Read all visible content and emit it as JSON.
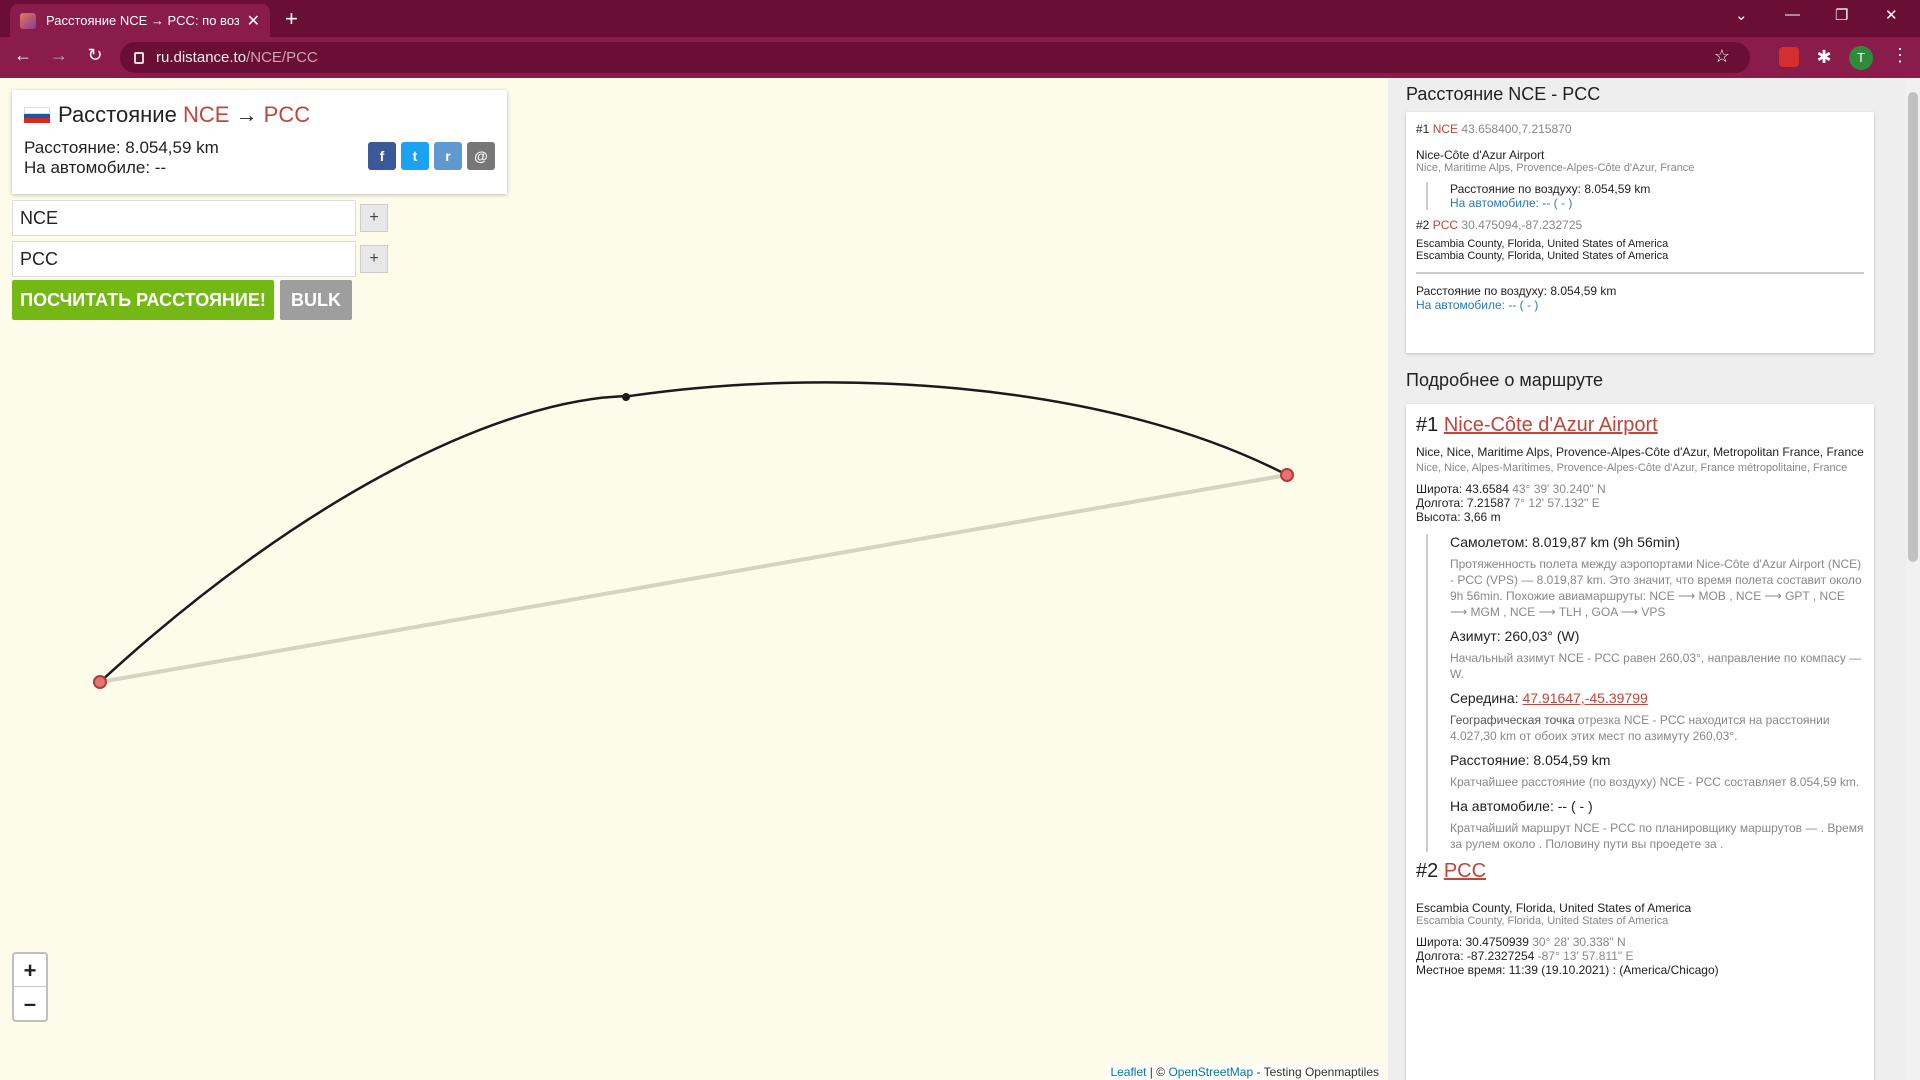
{
  "browser": {
    "tab_title": "Расстояние NCE → PCC: по возд",
    "url_host": "ru.distance.to",
    "url_path": "/NCE/PCC",
    "profile_initial": "T"
  },
  "header": {
    "title_prefix": "Расстояние",
    "from": "NCE",
    "arrow": "→",
    "to": "PCC",
    "distance": "Расстояние: 8.054,59 km",
    "drive": "На автомобиле: --"
  },
  "share": {
    "facebook": "f",
    "twitter": "t",
    "reddit": "r",
    "email": "@"
  },
  "form": {
    "from_value": "NCE",
    "to_value": "PCC",
    "plus": "+",
    "calc_label": "ПОСЧИТАТЬ РАССТОЯНИЕ!",
    "bulk_label": "BULK"
  },
  "map": {
    "zoom_in": "+",
    "zoom_out": "–",
    "attr_leaflet": "Leaflet",
    "attr_sep": " | © ",
    "attr_osm": "OpenStreetMap",
    "attr_rest": " - Testing Openmaptiles"
  },
  "summary": {
    "heading": "Расстояние NCE - PCC",
    "p1_num": "#1",
    "p1_code": "NCE",
    "p1_coords": "43.658400,7.215870",
    "p1_name": "Nice-Côte d'Azur Airport",
    "p1_region": "Nice, Maritime Alps, Provence-Alpes-Côte d'Azur, France",
    "leg_air": "Расстояние по воздуху: 8.054,59 km",
    "leg_drive": "На автомобиле: -- ( - )",
    "p2_num": "#2",
    "p2_code": "PCC",
    "p2_coords": "30.475094,-87.232725",
    "p2_region1": "Escambia County, Florida, United States of America",
    "p2_region2": "Escambia County, Florida, United States of America",
    "total_air": "Расстояние по воздуху: 8.054,59 km",
    "total_drive": "На автомобиле: -- ( - )"
  },
  "details": {
    "heading": "Подробнее о маршруте",
    "p1_num": "#1",
    "p1_name": "Nice-Côte d'Azur Airport",
    "p1_addr": "Nice, Nice, Maritime Alps, Provence-Alpes-Côte d'Azur, Metropolitan France, France",
    "p1_addr_local": "Nice, Nice, Alpes-Maritimes, Provence-Alpes-Côte d'Azur, France métropolitaine, France",
    "p1_lat_label": "Широта: 43.6584",
    "p1_lat_dms": "43° 39' 30.240\" N",
    "p1_lon_label": "Долгота: 7.21587",
    "p1_lon_dms": "7° 12' 57.132\" E",
    "p1_alt": "Высота: 3,66 m",
    "flight_title": "Самолетом: 8.019,87 km (9h 56min)",
    "flight_desc": "Протяженность полета между аэропортами Nice-Côte d'Azur Airport (NCE) - PCC (VPS) — 8.019,87 km. Это значит, что время полета составит около 9h 56min. Похожие авиамаршруты: NCE ⟶ MOB , NCE ⟶ GPT , NCE ⟶ MGM , NCE ⟶ TLH , GOA ⟶ VPS",
    "azimuth_title": "Азимут: 260,03° (W)",
    "azimuth_desc": "Начальный азимут NCE - PCC равен 260,03°, направление по компасу — W.",
    "mid_title": "Середина: ",
    "mid_link": "47.91647,-45.39799",
    "mid_desc_a": "Географическая точка",
    "mid_desc_b": " отрезка NCE - PCC находится на расстоянии 4.027,30 km от обоих этих мест по азимуту 260,03°.",
    "dist_title": "Расстояние: 8.054,59 km",
    "dist_desc": "Кратчайшее расстояние (по воздуху) NCE - PCC составляет 8.054,59 km.",
    "drive_title": "На автомобиле: -- ( - )",
    "drive_desc": "Кратчайший маршрут NCE - PCC по планировщику маршрутов — . Время за рулем около . Половину пути вы проедете за .",
    "p2_num": "#2",
    "p2_name": "PCC",
    "p2_addr": "Escambia County, Florida, United States of America",
    "p2_addr_local": "Escambia County, Florida, United States of America",
    "p2_lat_label": "Широта: 30.4750939",
    "p2_lat_dms": "30° 28' 30.338\" N",
    "p2_lon_label": "Долгота: -87.2327254",
    "p2_lon_dms": "-87° 13' 57.811\" E",
    "p2_time": "Местное время: 11:39 (19.10.2021) : (America/Chicago)"
  },
  "colors": {
    "accent_red": "#c0463a",
    "calc_green": "#74b816",
    "chrome": "#891c4a"
  }
}
